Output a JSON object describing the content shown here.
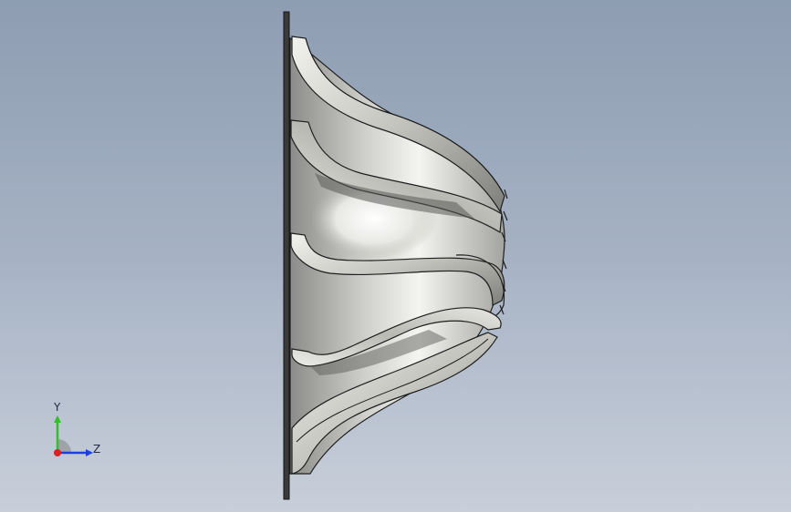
{
  "viewport": {
    "background_top": "#8e9db2",
    "background_bottom": "#c8cfda"
  },
  "model": {
    "icon": "impeller-shroud-model",
    "face_color": "#d9d9d6",
    "edge_color": "#1e1e1e"
  },
  "triad": {
    "y_label": "Y",
    "z_label": "Z",
    "y_color": "#2ec227",
    "z_color": "#1f3fe0",
    "x_color": "#e02020"
  }
}
